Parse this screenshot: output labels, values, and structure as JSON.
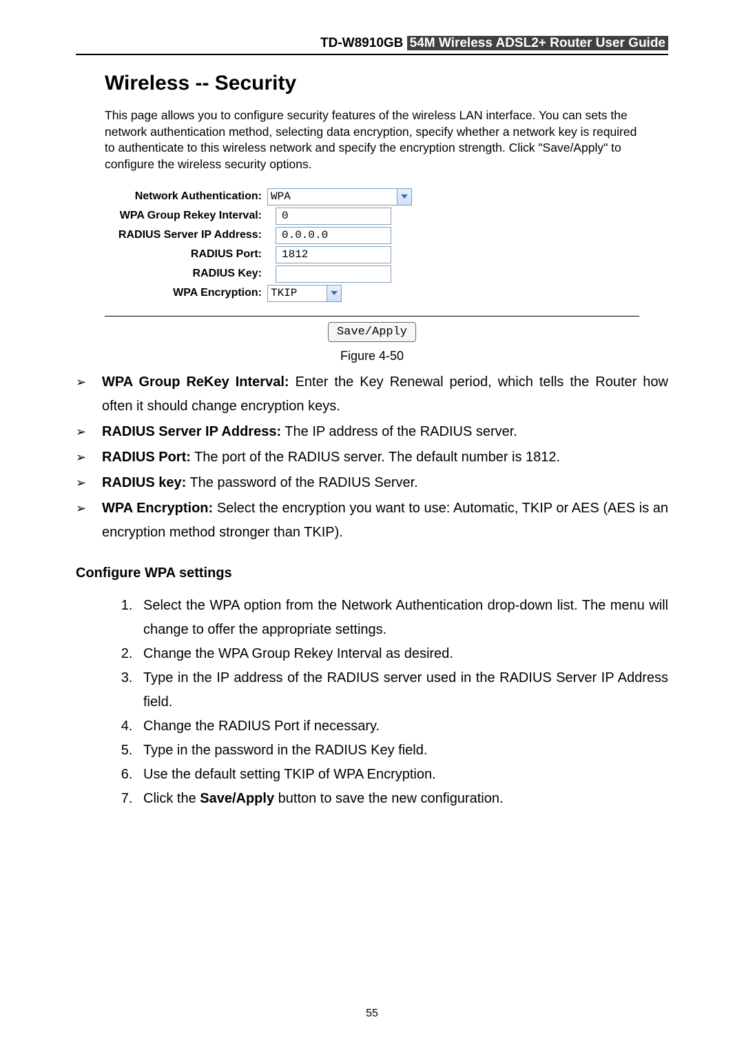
{
  "header": {
    "model": "TD-W8910GB",
    "title_rest": "54M  Wireless  ADSL2+  Router  User  Guide"
  },
  "figure": {
    "heading": "Wireless -- Security",
    "description": "This page allows you to configure security features of the wireless LAN interface. You can sets the network authentication method, selecting data encryption, specify whether a network key is required to authenticate to this wireless network and specify the encryption strength. Click \"Save/Apply\" to configure the wireless security options.",
    "labels": {
      "network_auth": "Network Authentication:",
      "rekey_interval": "WPA Group Rekey Interval:",
      "radius_ip": "RADIUS Server IP Address:",
      "radius_port": "RADIUS Port:",
      "radius_key": "RADIUS Key:",
      "wpa_encryption": "WPA Encryption:"
    },
    "values": {
      "network_auth": "WPA",
      "rekey_interval": "0",
      "radius_ip": "0.0.0.0",
      "radius_port": "1812",
      "radius_key": "",
      "wpa_encryption": "TKIP"
    },
    "save_button": "Save/Apply",
    "caption": "Figure 4-50"
  },
  "bullets": [
    {
      "label": "WPA Group ReKey Interval:",
      "text": " Enter the Key Renewal period, which tells the Router how often it should change encryption keys."
    },
    {
      "label": "RADIUS Server IP Address:",
      "text": " The IP address of the RADIUS server."
    },
    {
      "label": "RADIUS Port:",
      "text": " The port of the RADIUS server. The default number is 1812."
    },
    {
      "label": "RADIUS key:",
      "text": " The password of the RADIUS Server."
    },
    {
      "label": "WPA Encryption:",
      "text": " Select the encryption you want to use: Automatic, TKIP or AES (AES is an encryption method stronger than TKIP)."
    }
  ],
  "section_heading": "Configure WPA settings",
  "steps": [
    "Select the WPA option from the Network Authentication drop-down list. The menu will change to offer the appropriate settings.",
    "Change the WPA Group Rekey Interval as desired.",
    "Type in the IP address of the RADIUS server used in the RADIUS Server IP Address field.",
    "Change the RADIUS Port if necessary.",
    "Type in the password in the RADIUS Key field.",
    "Use the default setting TKIP of WPA Encryption.",
    "Click the <b>Save/Apply</b> button to save the new configuration."
  ],
  "page_number": "55"
}
